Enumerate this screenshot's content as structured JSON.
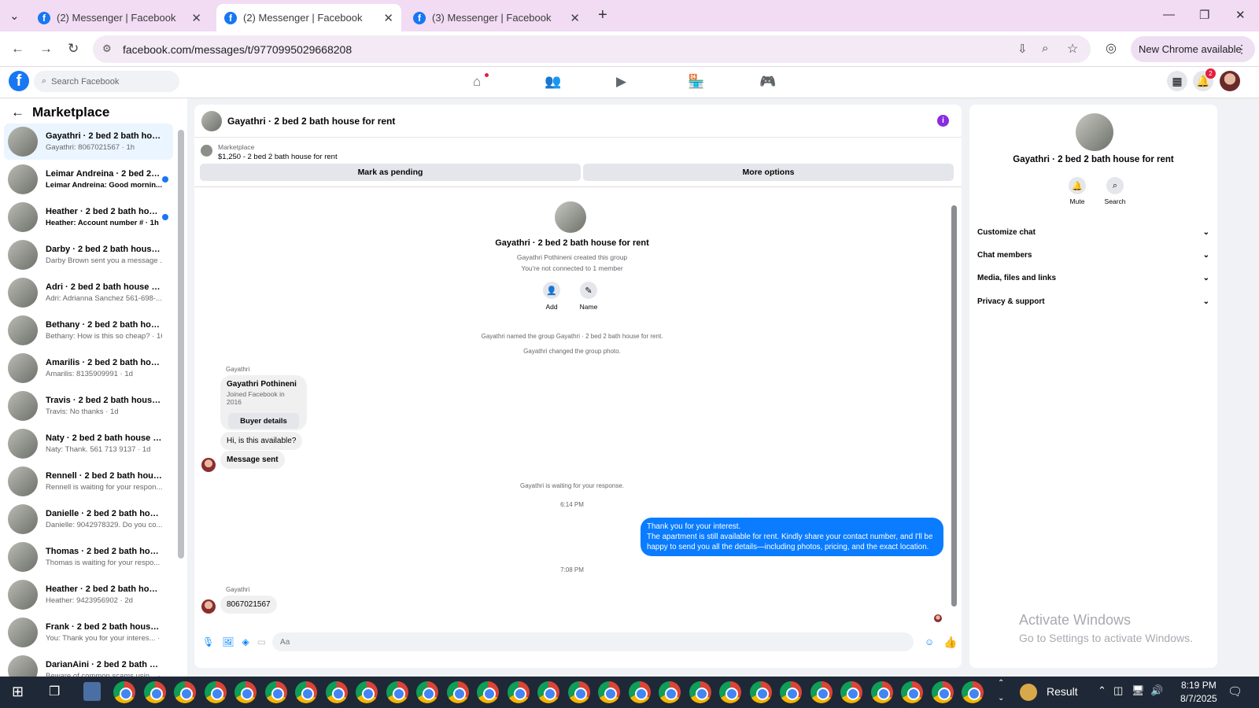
{
  "browser": {
    "tabs": [
      {
        "label": "(2) Messenger | Facebook",
        "active": false
      },
      {
        "label": "(2) Messenger | Facebook",
        "active": true
      },
      {
        "label": "(3) Messenger | Facebook",
        "active": false
      }
    ],
    "url": "facebook.com/messages/t/9770995029668208",
    "new_chrome_label": "New Chrome available"
  },
  "fb": {
    "search_placeholder": "Search Facebook",
    "notification_count": "2"
  },
  "sidebar": {
    "title": "Marketplace",
    "conversations": [
      {
        "name": "Gayathri · 2 bed 2 bath house f...",
        "preview": "Gayathri: 8067021567 · 1h",
        "active": true,
        "unread": false
      },
      {
        "name": "Leimar Andreina · 2 bed 2 bat...",
        "preview": "Leimar Andreina: Good mornin... · 1h",
        "active": false,
        "unread": true
      },
      {
        "name": "Heather · 2 bed 2 bath house...",
        "preview": "Heather: Account number # · 1h",
        "active": false,
        "unread": true
      },
      {
        "name": "Darby · 2 bed 2 bath house for ...",
        "preview": "Darby Brown sent you a message ... · 5h",
        "active": false,
        "unread": false
      },
      {
        "name": "Adri · 2 bed 2 bath house for re...",
        "preview": "Adri: Adrianna Sanchez 561-698-... · 15h",
        "active": false,
        "unread": false
      },
      {
        "name": "Bethany · 2 bed 2 bath house f...",
        "preview": "Bethany: How is this so cheap? · 16h",
        "active": false,
        "unread": false
      },
      {
        "name": "Amarilis · 2 bed 2 bath house f...",
        "preview": "Amarilis: 8135909991 · 1d",
        "active": false,
        "unread": false
      },
      {
        "name": "Travis · 2 bed 2 bath house for ...",
        "preview": "Travis: No thanks · 1d",
        "active": false,
        "unread": false
      },
      {
        "name": "Naty · 2 bed 2 bath house for r...",
        "preview": "Naty: Thank. 561 713 9137 · 1d",
        "active": false,
        "unread": false
      },
      {
        "name": "Rennell · 2 bed 2 bath house fo...",
        "preview": "Rennell is waiting for your respon... · 1d",
        "active": false,
        "unread": false
      },
      {
        "name": "Danielle · 2 bed 2 bath house f...",
        "preview": "Danielle: 9042978329. Do you co... · 1d",
        "active": false,
        "unread": false
      },
      {
        "name": "Thomas · 2 bed 2 bath house f...",
        "preview": "Thomas is waiting for your respo... · 2d",
        "active": false,
        "unread": false
      },
      {
        "name": "Heather · 2 bed 2 bath house f...",
        "preview": "Heather: 9423956902 · 2d",
        "active": false,
        "unread": false
      },
      {
        "name": "Frank · 2 bed 2 bath house f...",
        "preview": "You: Thank you for your interes... · 2d",
        "active": false,
        "unread": false
      },
      {
        "name": "DarianAini · 2 bed 2 bath ho...",
        "preview": "Beware of common scams usin... · 2d",
        "active": false,
        "unread": false
      }
    ]
  },
  "chat": {
    "title": "Gayathri · 2 bed 2 bath house for rent",
    "marketplace_label": "Marketplace",
    "listing": "$1,250 - 2 bed 2 bath house for rent",
    "mark_pending": "Mark as pending",
    "more_options": "More options",
    "group_title": "Gayathri · 2 bed 2 bath house for rent",
    "created_by": "Gayathri Pothineni created this group",
    "connected": "You're not connected to 1 member",
    "add_label": "Add",
    "name_label": "Name",
    "sys1": "Gayathri named the group Gayathri · 2 bed 2 bath house for rent.",
    "sys2": "Gayathri changed the group photo.",
    "sender": "Gayathri",
    "buyer_name": "Gayathri Pothineni",
    "buyer_joined": "Joined Facebook in 2016",
    "buyer_details": "Buyer details",
    "msg_available": "Hi, is this available?",
    "msg_sent": "Message sent",
    "waiting": "Gayathri is waiting for your response.",
    "time1": "6:14 PM",
    "out_line1": "Thank you for your interest.",
    "out_line2": "The apartment is still available for rent. Kindly share your contact number, and I'll be happy to send you all the details—including photos, pricing, and the exact location.",
    "time2": "7:08 PM",
    "msg_phone": "8067021567",
    "composer_placeholder": "Aa"
  },
  "right_panel": {
    "title": "Gayathri · 2 bed 2 bath house for rent",
    "mute": "Mute",
    "search": "Search",
    "sections": [
      "Customize chat",
      "Chat members",
      "Media, files and links",
      "Privacy & support"
    ]
  },
  "watermark": {
    "line1": "Activate Windows",
    "line2": "Go to Settings to activate Windows."
  },
  "taskbar": {
    "result_label": "Result",
    "time": "8:19 PM",
    "date": "8/7/2025"
  },
  "colors": {
    "fb_blue": "#1877f2",
    "messenger_blue": "#0a7cff",
    "unread_dot": "#1877f2"
  }
}
